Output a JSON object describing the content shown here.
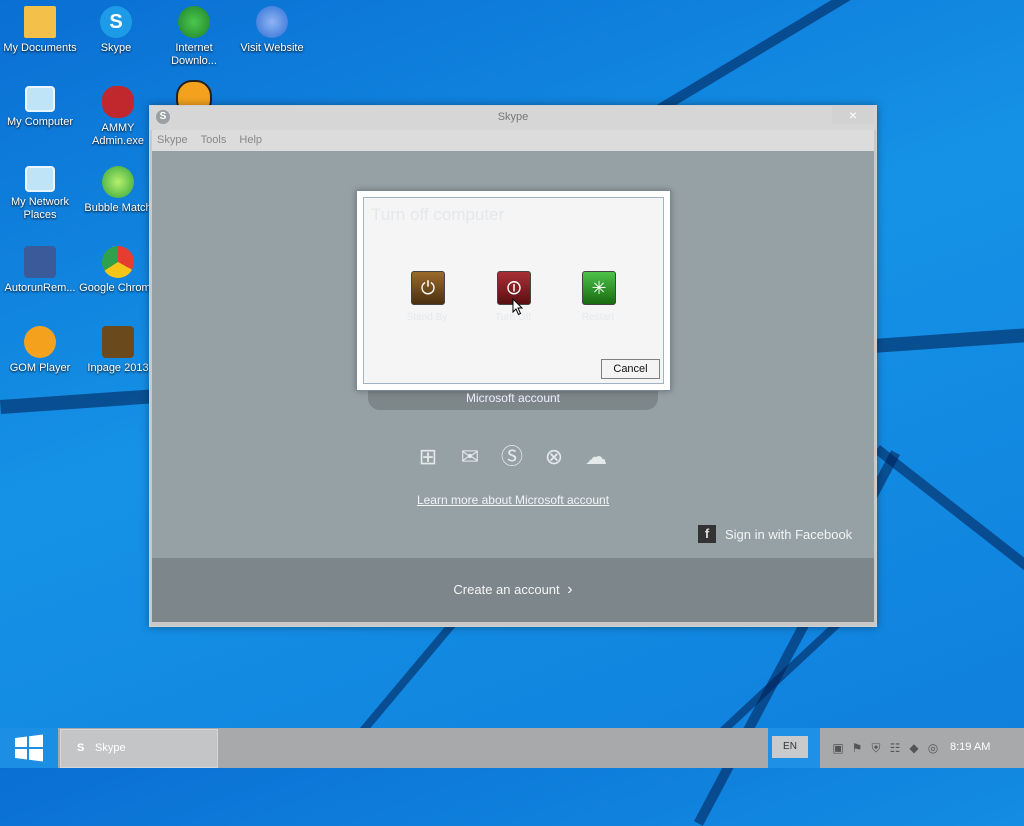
{
  "desktop": {
    "icons": [
      {
        "label": "My Documents",
        "icon": "folder-icon",
        "color": "#f3c14a"
      },
      {
        "label": "Skype",
        "icon": "skype-icon",
        "color": "#1e9be6"
      },
      {
        "label": "Internet\nDownlo...",
        "icon": "idm-icon",
        "color": "#1f7f2a"
      },
      {
        "label": "Visit Website",
        "icon": "globe-icon",
        "color": "#2d6ed5"
      },
      {
        "label": "My Computer",
        "icon": "computer-icon",
        "color": "#bfe4f7"
      },
      {
        "label": "AMMY\nAdmin.exe",
        "icon": "ammy-icon",
        "color": "#c0282e"
      },
      {
        "label": "My Network\nPlaces",
        "icon": "network-icon",
        "color": "#bfe4f7"
      },
      {
        "label": "Bubble Match",
        "icon": "bubble-icon",
        "color": "#2fa23a"
      },
      {
        "label": "AutorunRem...",
        "icon": "autorun-icon",
        "color": "#3a5a9a"
      },
      {
        "label": "Google Chrome",
        "icon": "chrome-icon",
        "color": "#e53d2f"
      },
      {
        "label": "GOM Player",
        "icon": "gom-icon",
        "color": "#f4a21e"
      },
      {
        "label": "Inpage 2013",
        "icon": "inpage-icon",
        "color": "#6a4a1c"
      }
    ]
  },
  "skype_window": {
    "title": "Skype",
    "close_symbol": "×",
    "menu": [
      "Skype",
      "Tools",
      "Help"
    ],
    "ms_account_label": "Microsoft account",
    "service_icons": [
      "windows-icon",
      "outlook-icon",
      "skype-icon",
      "xbox-icon",
      "onedrive-icon"
    ],
    "learn_more_link": "Learn more about Microsoft account",
    "facebook_signin": "Sign in with Facebook",
    "create_account": "Create an account",
    "create_chevron": "›"
  },
  "turn_off_dialog": {
    "title": "Turn off computer",
    "buttons": [
      {
        "label": "Stand By",
        "icon": "standby-icon",
        "color": "#6b4a1e"
      },
      {
        "label": "Turn Off",
        "icon": "power-icon",
        "color": "#7a1a1e"
      },
      {
        "label": "Restart",
        "icon": "restart-icon",
        "color": "#2a8a1a"
      }
    ],
    "cancel_label": "Cancel"
  },
  "taskbar": {
    "task_label": "Skype",
    "task_icon_letter": "S",
    "language": "EN",
    "tray_icons": [
      "display-icon",
      "flag-icon",
      "shield-icon",
      "network-icon",
      "speaker-icon",
      "sync-icon"
    ],
    "clock": "8:19 AM"
  },
  "colors": {
    "desktop_blue": "#1592e6",
    "taskbar_gray": "#a7a9ab",
    "start_blue": "#1c8ee3"
  }
}
